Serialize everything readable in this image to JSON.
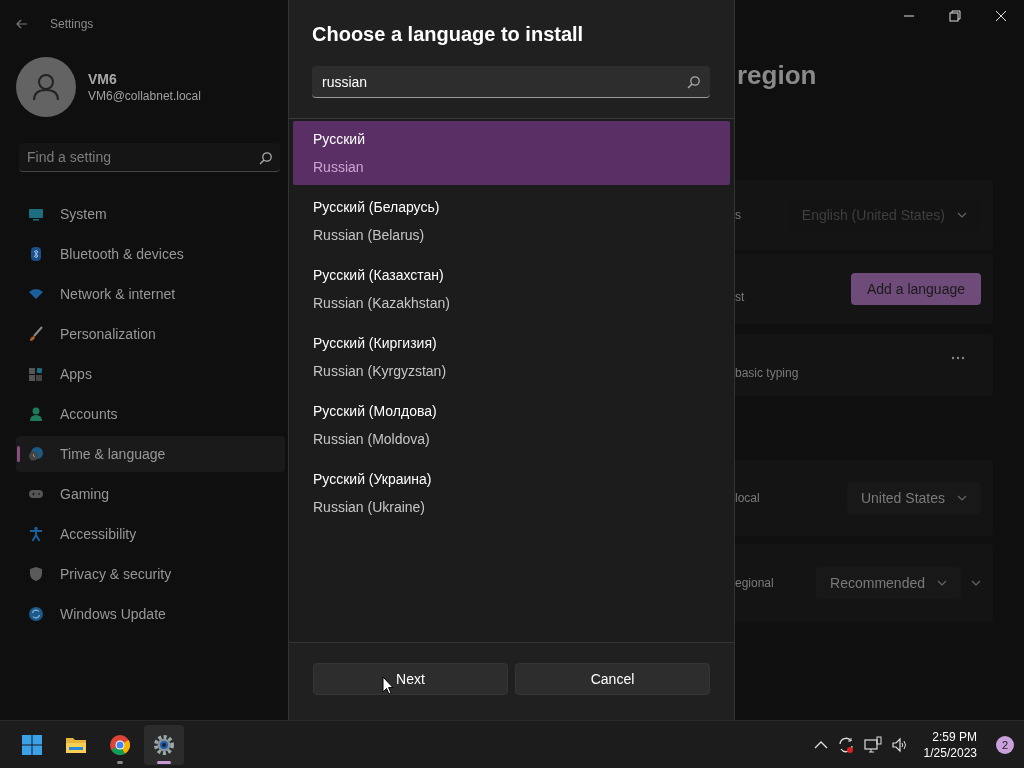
{
  "window": {
    "title": "Settings"
  },
  "account": {
    "name": "VM6",
    "email": "VM6@collabnet.local"
  },
  "sidebar": {
    "search": {
      "placeholder": "Find a setting"
    },
    "items": [
      {
        "label": "System",
        "selected": false
      },
      {
        "label": "Bluetooth & devices",
        "selected": false
      },
      {
        "label": "Network & internet",
        "selected": false
      },
      {
        "label": "Personalization",
        "selected": false
      },
      {
        "label": "Apps",
        "selected": false
      },
      {
        "label": "Accounts",
        "selected": false
      },
      {
        "label": "Time & language",
        "selected": true
      },
      {
        "label": "Gaming",
        "selected": false
      },
      {
        "label": "Accessibility",
        "selected": false
      },
      {
        "label": "Privacy & security",
        "selected": false
      },
      {
        "label": "Windows Update",
        "selected": false
      }
    ]
  },
  "page": {
    "heading": "region",
    "rows": [
      {
        "kind": "dropdown",
        "label": "s",
        "value": "English (United States)",
        "disabled": true
      },
      {
        "kind": "button",
        "label": "st",
        "value": "Add a language",
        "disabled": false
      },
      {
        "kind": "more",
        "label": "basic typing",
        "disabled": false
      },
      {
        "kind": "dropdown",
        "label": "local",
        "value": "United States",
        "disabled": false
      },
      {
        "kind": "dropdown-expand",
        "label": "egional",
        "value": "Recommended",
        "disabled": false
      }
    ]
  },
  "dialog": {
    "title": "Choose a language to install",
    "search": {
      "value": "russian"
    },
    "results": [
      {
        "name": "Русский",
        "english": "Russian",
        "selected": true
      },
      {
        "name": "Русский (Беларусь)",
        "english": "Russian (Belarus)",
        "selected": false
      },
      {
        "name": "Русский (Казахстан)",
        "english": "Russian (Kazakhstan)",
        "selected": false
      },
      {
        "name": "Русский (Киргизия)",
        "english": "Russian (Kyrgyzstan)",
        "selected": false
      },
      {
        "name": "Русский (Молдова)",
        "english": "Russian (Moldova)",
        "selected": false
      },
      {
        "name": "Русский (Украина)",
        "english": "Russian (Ukraine)",
        "selected": false
      }
    ],
    "buttons": [
      "Next",
      "Cancel"
    ]
  },
  "taskbar": {
    "apps": [
      {
        "selected": false,
        "running": false
      },
      {
        "selected": false,
        "running": false
      },
      {
        "selected": false,
        "running": true
      },
      {
        "selected": true,
        "running": true
      }
    ],
    "clock": {
      "time": "2:59 PM",
      "date": "1/25/2023"
    },
    "notification_count": "2"
  }
}
